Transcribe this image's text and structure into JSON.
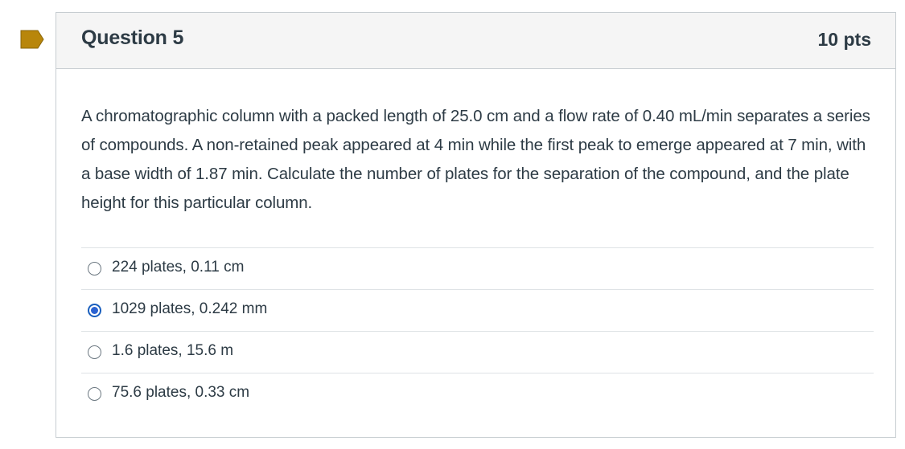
{
  "flag": {
    "icon": "bookmark-flag-icon",
    "color": "#b8860b"
  },
  "question": {
    "title": "Question 5",
    "points": "10 pts",
    "body": "A chromatographic column with a packed length of 25.0 cm and a flow rate of 0.40 mL/min separates a series of compounds. A non-retained peak appeared at 4 min while the first peak to emerge appeared at 7 min, with a base width of 1.87 min. Calculate the number of plates for the separation of the compound, and the plate height for this particular column.",
    "answers": [
      {
        "label": "224 plates, 0.11 cm",
        "selected": false
      },
      {
        "label": "1029 plates, 0.242 mm",
        "selected": true
      },
      {
        "label": "1.6 plates, 15.6 m",
        "selected": false
      },
      {
        "label": "75.6 plates, 0.33 cm",
        "selected": false
      }
    ]
  },
  "colors": {
    "selected_radio": "#2b62d1",
    "header_bg": "#f5f5f5",
    "border": "#c7cdd1"
  }
}
